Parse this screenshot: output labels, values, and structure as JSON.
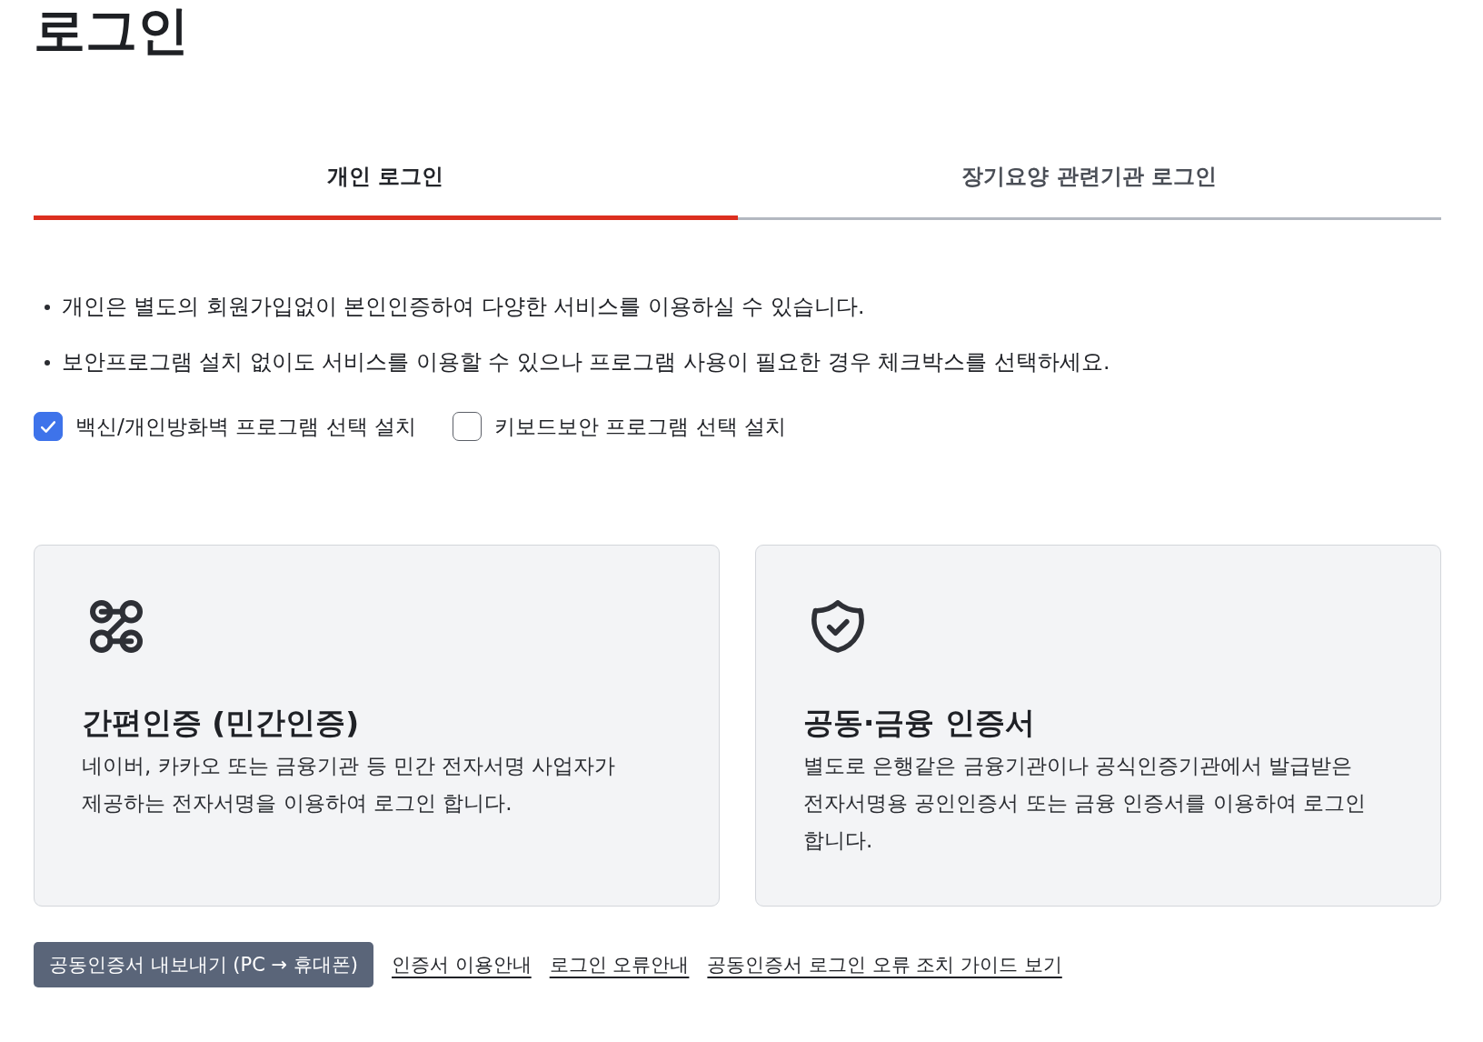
{
  "page": {
    "title": "로그인"
  },
  "tabs": [
    {
      "label": "개인 로그인",
      "selected": true
    },
    {
      "label": "장기요양 관련기관 로그인",
      "selected": false
    }
  ],
  "notices": [
    "개인은 별도의 회원가입없이 본인인증하여 다양한 서비스를 이용하실 수 있습니다.",
    "보안프로그램 설치 없이도 서비스를 이용할 수 있으나 프로그램 사용이 필요한 경우 체크박스를 선택하세요."
  ],
  "options": [
    {
      "label": "백신/개인방화벽 프로그램 선택 설치",
      "checked": true
    },
    {
      "label": "키보드보안 프로그램 선택 설치",
      "checked": false
    }
  ],
  "login_methods": [
    {
      "kind": "simple",
      "title": "간편인증 (민간인증)",
      "description": "네이버, 카카오 또는 금융기관 등 민간 전자서명 사업자가 제공하는 전자서명을 이용하여 로그인 합니다."
    },
    {
      "kind": "certificate",
      "title": "공동·금융 인증서",
      "description": "별도로 은행같은 금융기관이나 공식인증기관에서 발급받은 전자서명용 공인인증서 또는 금융 인증서를 이용하여 로그인 합니다."
    }
  ],
  "actions": [
    {
      "kind": "button",
      "label": "공동인증서 내보내기 (PC → 휴대폰)"
    },
    {
      "kind": "link",
      "label": "인증서 이용안내"
    },
    {
      "kind": "link",
      "label": "로그인 오류안내"
    },
    {
      "kind": "link",
      "label": "공동인증서 로그인 오류 조치 가이드 보기"
    }
  ]
}
